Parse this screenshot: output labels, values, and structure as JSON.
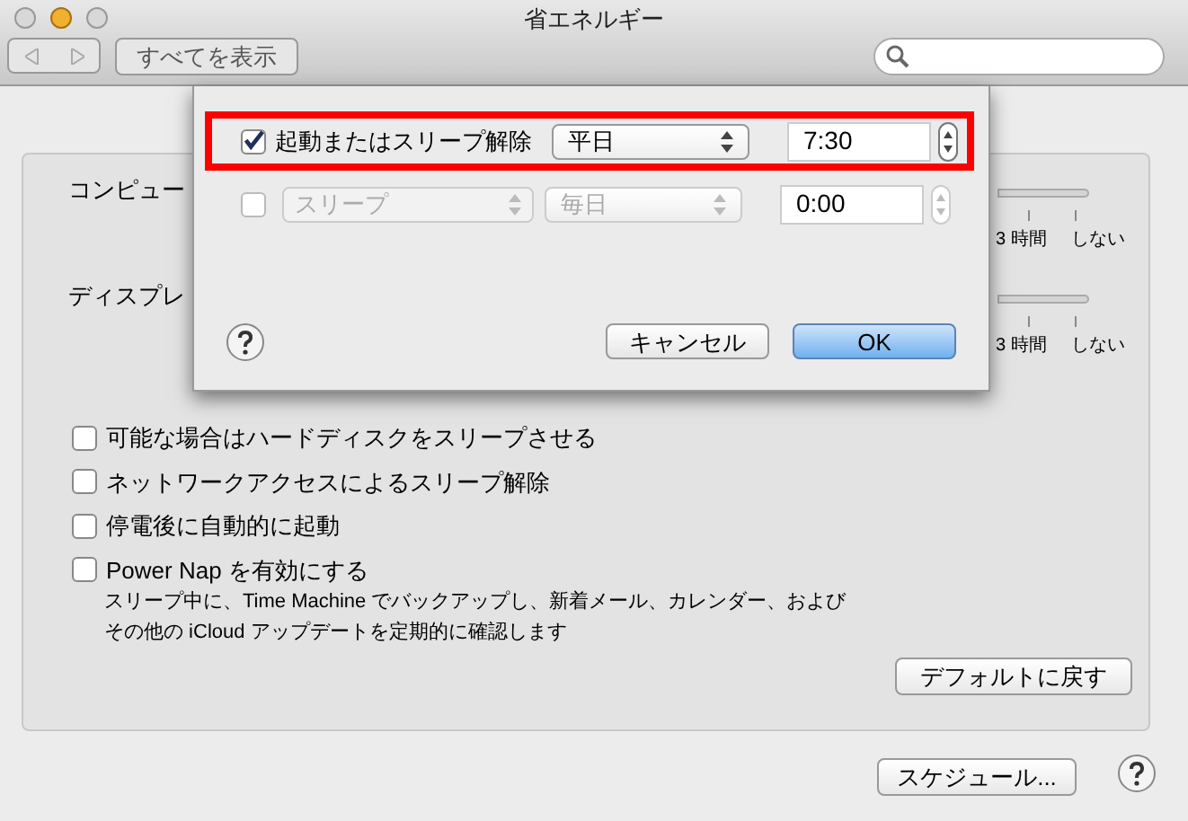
{
  "window": {
    "title": "省エネルギー",
    "show_all_button": "すべてを表示"
  },
  "sleep_rows": [
    {
      "label": "コンピュー",
      "scale_labels": [
        "3 時間",
        "しない"
      ]
    },
    {
      "label": "ディスプレ",
      "scale_labels": [
        "3 時間",
        "しない"
      ]
    }
  ],
  "options": [
    {
      "label": "可能な場合はハードディスクをスリープさせる",
      "checked": false
    },
    {
      "label": "ネットワークアクセスによるスリープ解除",
      "checked": false
    },
    {
      "label": "停電後に自動的に起動",
      "checked": false
    },
    {
      "label": "Power Nap を有効にする",
      "checked": false,
      "description": [
        "スリープ中に、Time Machine でバックアップし、新着メール、カレンダー、および",
        "その他の iCloud アップデートを定期的に確認します"
      ]
    }
  ],
  "default_button": "デフォルトに戻す",
  "schedule_button": "スケジュール...",
  "sheet": {
    "rows": [
      {
        "checked": true,
        "enabled": true,
        "highlighted": true,
        "action": "起動またはスリープ解除",
        "day": "平日",
        "time": "7:30"
      },
      {
        "checked": false,
        "enabled": false,
        "highlighted": false,
        "action": "スリープ",
        "day": "毎日",
        "time": "0:00"
      }
    ],
    "cancel_button": "キャンセル",
    "ok_button": "OK"
  }
}
